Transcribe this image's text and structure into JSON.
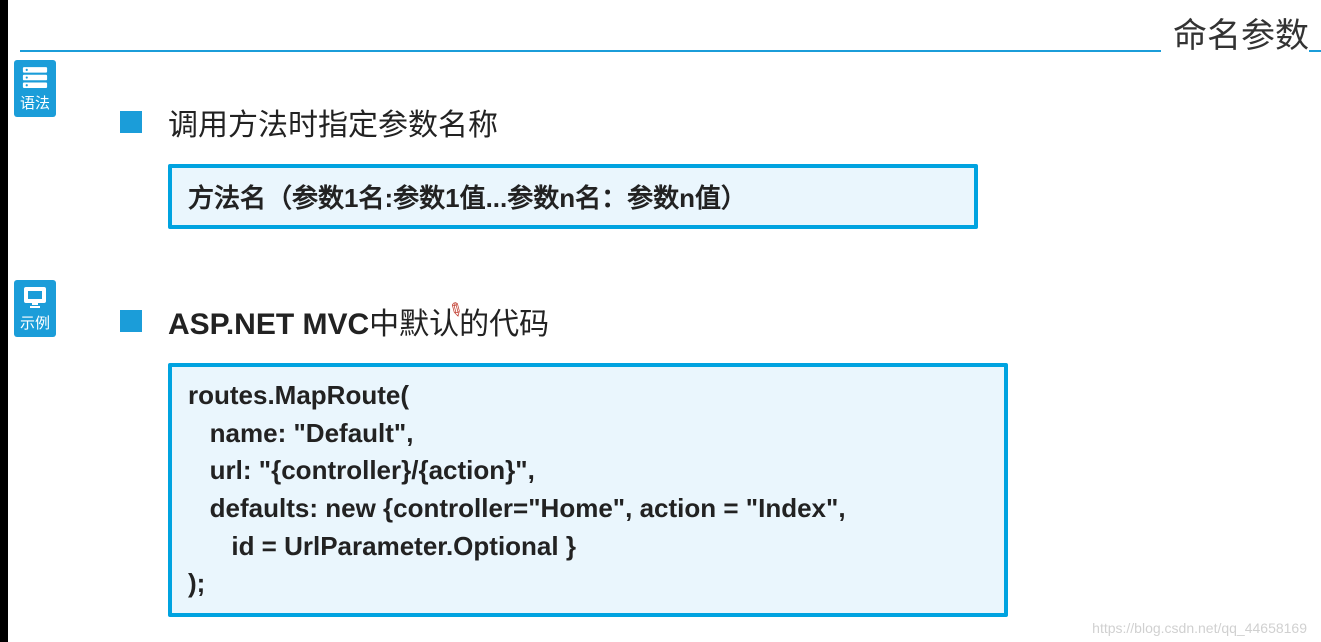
{
  "page_title": "命名参数",
  "sidebar": {
    "syntax_label": "语法",
    "example_label": "示例"
  },
  "section1": {
    "heading": "调用方法时指定参数名称",
    "syntax_text": "方法名（参数1名:参数1值...参数n名：参数n值）"
  },
  "section2": {
    "heading_bold": "ASP.NET MVC",
    "heading_rest": "中默认的代码",
    "code": "routes.MapRoute(\n   name: \"Default\",\n   url: \"{controller}/{action}\",\n   defaults: new {controller=\"Home\", action = \"Index\",\n      id = UrlParameter.Optional }\n);"
  },
  "watermark": "https://blog.csdn.net/qq_44658169"
}
